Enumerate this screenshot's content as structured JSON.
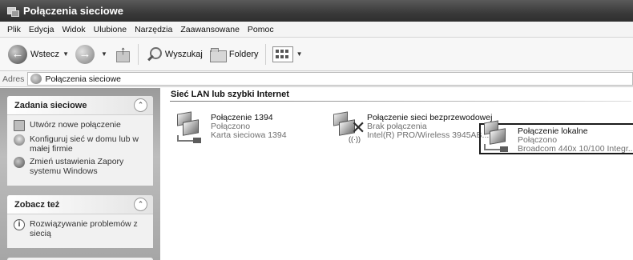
{
  "window": {
    "title": "Połączenia sieciowe"
  },
  "menu": [
    "Plik",
    "Edycja",
    "Widok",
    "Ulubione",
    "Narzędzia",
    "Zaawansowane",
    "Pomoc"
  ],
  "toolbar": {
    "back": "Wstecz",
    "search": "Wyszukaj",
    "folders": "Foldery"
  },
  "address": {
    "label": "Adres",
    "value": "Połączenia sieciowe"
  },
  "sidebar": {
    "tasks_panel": {
      "title": "Zadania sieciowe",
      "items": [
        {
          "label": "Utwórz nowe połączenie",
          "icon": "new-connection-icon"
        },
        {
          "label": "Konfiguruj sieć w domu lub w małej firmie",
          "icon": "home-network-icon"
        },
        {
          "label": "Zmień ustawienia Zapory systemu Windows",
          "icon": "firewall-icon"
        }
      ]
    },
    "see_also_panel": {
      "title": "Zobacz też",
      "items": [
        {
          "label": "Rozwiązywanie problemów z siecią",
          "icon": "help-icon"
        }
      ]
    }
  },
  "main": {
    "group_title": "Sieć LAN lub szybki Internet",
    "connections": [
      {
        "name": "Połączenie 1394",
        "status": "Połączono",
        "device": "Karta sieciowa 1394",
        "selected": false
      },
      {
        "name": "Połączenie sieci bezprzewodowej",
        "status": "Brak połączenia",
        "device": "Intel(R) PRO/Wireless 3945AB...",
        "selected": false
      },
      {
        "name": "Połączenie lokalne",
        "status": "Połączono",
        "device": "Broadcom 440x 10/100 Integr...",
        "selected": true
      }
    ]
  }
}
